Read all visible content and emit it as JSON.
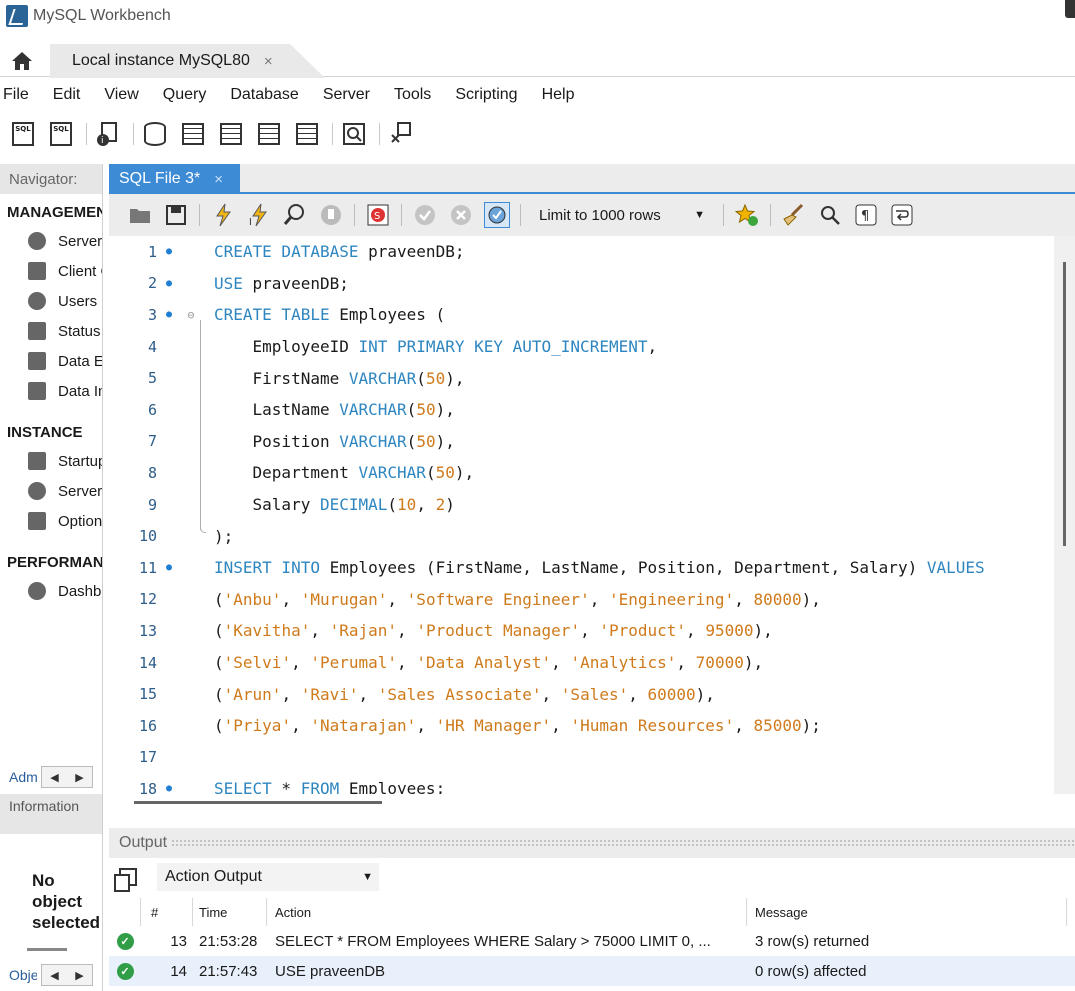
{
  "window": {
    "title": "MySQL Workbench"
  },
  "tabs": {
    "connection_tab": "Local instance MySQL80",
    "close_glyph": "×"
  },
  "menu": [
    "File",
    "Edit",
    "View",
    "Query",
    "Database",
    "Server",
    "Tools",
    "Scripting",
    "Help"
  ],
  "sidebar": {
    "navigator_label": "Navigator:",
    "management_title": "MANAGEMENT",
    "management_items": [
      "Server Status",
      "Client Connections",
      "Users and Privileges",
      "Status and System Variables",
      "Data Export",
      "Data Import/Restore"
    ],
    "instance_title": "INSTANCE",
    "instance_items": [
      "Startup / Shutdown",
      "Server Logs",
      "Options File"
    ],
    "performance_title": "PERFORMANCE",
    "performance_items": [
      "Dashboard"
    ],
    "administration_tab": "Administration",
    "information_label": "Information",
    "no_object_lines": [
      "No",
      "object",
      "selected"
    ],
    "object_tab": "Object Info"
  },
  "editor": {
    "tab_label": "SQL File 3*",
    "limit_label": "Limit to 1000 rows",
    "lines": [
      {
        "n": "1",
        "dot": true,
        "fold": "",
        "html": "<span class=\"kw\">CREATE DATABASE</span> praveenDB;"
      },
      {
        "n": "2",
        "dot": true,
        "fold": "",
        "html": "<span class=\"kw\">USE</span> praveenDB;"
      },
      {
        "n": "3",
        "dot": true,
        "fold": "⊖",
        "html": "<span class=\"kw\">CREATE TABLE</span> Employees ("
      },
      {
        "n": "4",
        "dot": false,
        "fold": "",
        "html": "    EmployeeID <span class=\"kw\">INT PRIMARY KEY AUTO_INCREMENT</span>,"
      },
      {
        "n": "5",
        "dot": false,
        "fold": "",
        "html": "    FirstName <span class=\"kw\">VARCHAR</span>(<span class=\"num\">50</span>),"
      },
      {
        "n": "6",
        "dot": false,
        "fold": "",
        "html": "    LastName <span class=\"kw\">VARCHAR</span>(<span class=\"num\">50</span>),"
      },
      {
        "n": "7",
        "dot": false,
        "fold": "",
        "html": "    Position <span class=\"kw\">VARCHAR</span>(<span class=\"num\">50</span>),"
      },
      {
        "n": "8",
        "dot": false,
        "fold": "",
        "html": "    Department <span class=\"kw\">VARCHAR</span>(<span class=\"num\">50</span>),"
      },
      {
        "n": "9",
        "dot": false,
        "fold": "",
        "html": "    Salary <span class=\"kw\">DECIMAL</span>(<span class=\"num\">10</span>, <span class=\"num\">2</span>)"
      },
      {
        "n": "10",
        "dot": false,
        "fold": "",
        "html": ");"
      },
      {
        "n": "11",
        "dot": true,
        "fold": "",
        "html": "<span class=\"kw\">INSERT INTO</span> Employees (FirstName, LastName, Position, Department, Salary) <span class=\"kw\">VALUES</span>"
      },
      {
        "n": "12",
        "dot": false,
        "fold": "",
        "html": "(<span class=\"str\">'Anbu'</span>, <span class=\"str\">'Murugan'</span>, <span class=\"str\">'Software Engineer'</span>, <span class=\"str\">'Engineering'</span>, <span class=\"num\">80000</span>),"
      },
      {
        "n": "13",
        "dot": false,
        "fold": "",
        "html": "(<span class=\"str\">'Kavitha'</span>, <span class=\"str\">'Rajan'</span>, <span class=\"str\">'Product Manager'</span>, <span class=\"str\">'Product'</span>, <span class=\"num\">95000</span>),"
      },
      {
        "n": "14",
        "dot": false,
        "fold": "",
        "html": "(<span class=\"str\">'Selvi'</span>, <span class=\"str\">'Perumal'</span>, <span class=\"str\">'Data Analyst'</span>, <span class=\"str\">'Analytics'</span>, <span class=\"num\">70000</span>),"
      },
      {
        "n": "15",
        "dot": false,
        "fold": "",
        "html": "(<span class=\"str\">'Arun'</span>, <span class=\"str\">'Ravi'</span>, <span class=\"str\">'Sales Associate'</span>, <span class=\"str\">'Sales'</span>, <span class=\"num\">60000</span>),"
      },
      {
        "n": "16",
        "dot": false,
        "fold": "",
        "html": "(<span class=\"str\">'Priya'</span>, <span class=\"str\">'Natarajan'</span>, <span class=\"str\">'HR Manager'</span>, <span class=\"str\">'Human Resources'</span>, <span class=\"num\">85000</span>);"
      },
      {
        "n": "17",
        "dot": false,
        "fold": "",
        "html": ""
      },
      {
        "n": "18",
        "dot": true,
        "fold": "",
        "html": "<span class=\"kw\">SELECT</span> * <span class=\"kw\">FROM</span> Employees;"
      }
    ]
  },
  "output": {
    "panel_label": "Output",
    "mode_label": "Action Output",
    "columns": {
      "num": "#",
      "time": "Time",
      "action": "Action",
      "message": "Message"
    },
    "rows": [
      {
        "num": "13",
        "time": "21:53:28",
        "action": "SELECT * FROM Employees WHERE Salary > 75000 LIMIT 0, ...",
        "message": "3 row(s) returned"
      },
      {
        "num": "14",
        "time": "21:57:43",
        "action": "USE praveenDB",
        "message": "0 row(s) affected"
      }
    ]
  },
  "colors": {
    "accent": "#3d8ad5",
    "keyword": "#2e86c1",
    "string": "#cf7a1b",
    "ok": "#2f9e47"
  }
}
